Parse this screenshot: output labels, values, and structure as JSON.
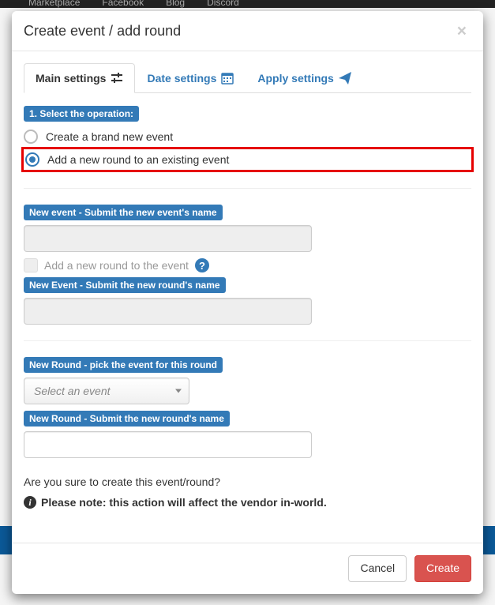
{
  "bg_nav": [
    "Marketplace",
    "Facebook",
    "Blog",
    "Discord"
  ],
  "modal": {
    "title": "Create event / add round",
    "tabs": [
      {
        "label": "Main settings",
        "icon": "sliders-icon",
        "active": true
      },
      {
        "label": "Date settings",
        "icon": "calendar-icon",
        "active": false
      },
      {
        "label": "Apply settings",
        "icon": "paper-plane-icon",
        "active": false
      }
    ],
    "step1_label": "1. Select the operation:",
    "radios": [
      {
        "label": "Create a brand new event",
        "checked": false,
        "highlight": false
      },
      {
        "label": "Add a new round to an existing event",
        "checked": true,
        "highlight": true
      }
    ],
    "new_event_name_label": "New event - Submit the new event's name",
    "add_round_chk_label": "Add a new round to the event",
    "new_event_round_label": "New Event - Submit the new round's name",
    "new_round_pick_label": "New Round - pick the event for this round",
    "event_select_placeholder": "Select an event",
    "new_round_name_label": "New Round - Submit the new round's name",
    "confirm_text": "Are you sure to create this event/round?",
    "note_text": "Please note: this action will affect the vendor in-world.",
    "cancel_label": "Cancel",
    "create_label": "Create"
  }
}
